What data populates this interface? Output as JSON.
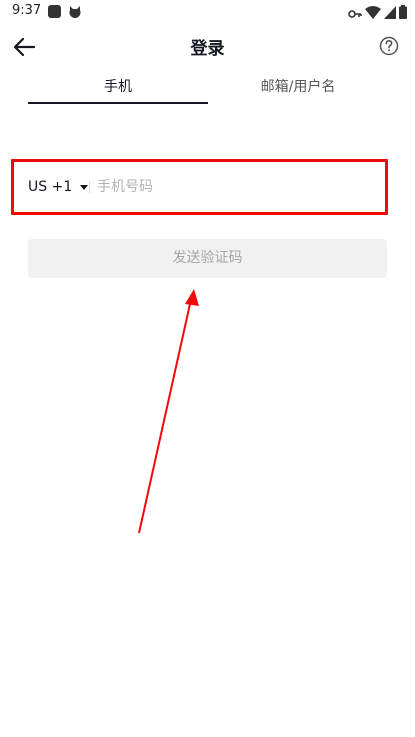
{
  "status_bar": {
    "time": "9:37"
  },
  "header": {
    "title": "登录"
  },
  "tabs": [
    {
      "label": "手机",
      "active": true
    },
    {
      "label": "邮箱/用户名",
      "active": false
    }
  ],
  "phone_form": {
    "country_code": "US +1",
    "placeholder": "手机号码",
    "value": ""
  },
  "send_code_button": {
    "label": "发送验证码",
    "enabled": false
  },
  "annotation": {
    "highlight_color": "#ee0a0a",
    "arrow_color": "#ee0a0a"
  },
  "colors": {
    "primary_text": "#161823",
    "disabled_button_bg": "#f1f1f2",
    "disabled_button_text": "#a6a6a6"
  }
}
